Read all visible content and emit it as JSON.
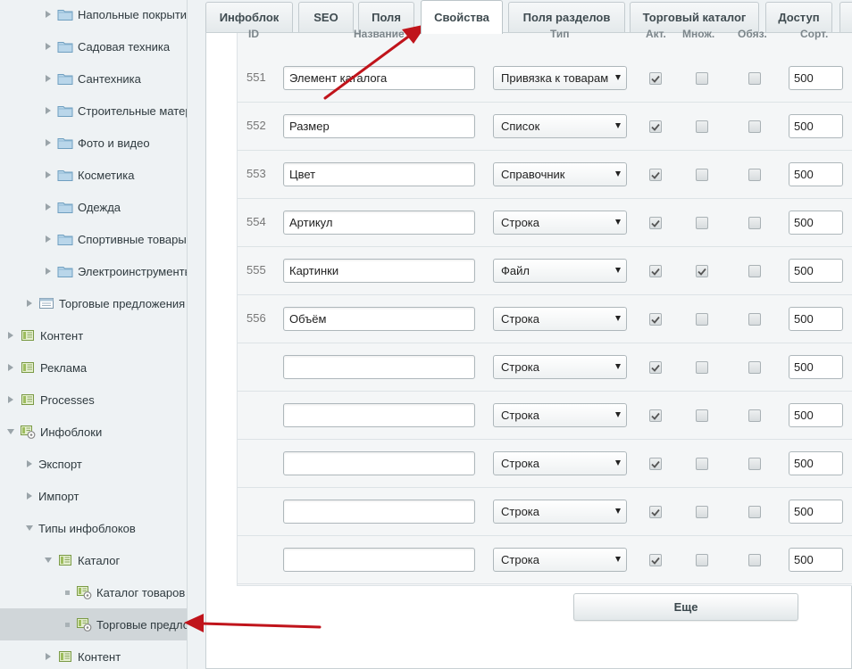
{
  "sidebar": {
    "items": [
      {
        "label": "Напольные покрытия",
        "level": 2,
        "expander": "collapsed",
        "icon": "folder-icon"
      },
      {
        "label": "Садовая техника",
        "level": 2,
        "expander": "collapsed",
        "icon": "folder-icon"
      },
      {
        "label": "Сантехника",
        "level": 2,
        "expander": "collapsed",
        "icon": "folder-icon"
      },
      {
        "label": "Строительные материалы",
        "level": 2,
        "expander": "collapsed",
        "icon": "folder-icon"
      },
      {
        "label": "Фото и видео",
        "level": 2,
        "expander": "collapsed",
        "icon": "folder-icon"
      },
      {
        "label": "Косметика",
        "level": 2,
        "expander": "collapsed",
        "icon": "folder-icon"
      },
      {
        "label": "Одежда",
        "level": 2,
        "expander": "collapsed",
        "icon": "folder-icon"
      },
      {
        "label": "Спортивные товары",
        "level": 2,
        "expander": "collapsed",
        "icon": "folder-icon"
      },
      {
        "label": "Электроинструменты",
        "level": 2,
        "expander": "collapsed",
        "icon": "folder-icon"
      },
      {
        "label": "Торговые предложения",
        "level": 1,
        "expander": "collapsed",
        "icon": "table-icon"
      },
      {
        "label": "Контент",
        "level": 0,
        "expander": "collapsed",
        "icon": "module-icon"
      },
      {
        "label": "Реклама",
        "level": 0,
        "expander": "collapsed",
        "icon": "module-icon"
      },
      {
        "label": "Processes",
        "level": 0,
        "expander": "collapsed",
        "icon": "module-icon"
      },
      {
        "label": "Инфоблоки",
        "level": 0,
        "expander": "expanded",
        "icon": "module-gear-icon"
      },
      {
        "label": "Экспорт",
        "level": 1,
        "expander": "collapsed",
        "icon": ""
      },
      {
        "label": "Импорт",
        "level": 1,
        "expander": "collapsed",
        "icon": ""
      },
      {
        "label": "Типы инфоблоков",
        "level": 1,
        "expander": "expanded",
        "icon": ""
      },
      {
        "label": "Каталог",
        "level": 2,
        "expander": "expanded",
        "icon": "module-icon"
      },
      {
        "label": "Каталог товаров",
        "level": 3,
        "expander": "bullet",
        "icon": "module-gear-icon"
      },
      {
        "label": "Торговые предложения",
        "level": 3,
        "expander": "bullet",
        "icon": "module-gear-icon",
        "selected": true
      },
      {
        "label": "Контент",
        "level": 2,
        "expander": "collapsed",
        "icon": "module-icon"
      }
    ]
  },
  "tabs": [
    {
      "label": "Инфоблок"
    },
    {
      "label": "SEO"
    },
    {
      "label": "Поля"
    },
    {
      "label": "Свойства",
      "active": true
    },
    {
      "label": "Поля разделов"
    },
    {
      "label": "Торговый каталог"
    },
    {
      "label": "Доступ"
    }
  ],
  "columns": [
    "ID",
    "Название",
    "Тип",
    "Акт.",
    "Множ.",
    "Обяз.",
    "Сорт."
  ],
  "rows": [
    {
      "id": "551",
      "name": "Элемент каталога",
      "type": "Привязка к товарам",
      "active": true,
      "multiple": false,
      "required": false,
      "sort": "500"
    },
    {
      "id": "552",
      "name": "Размер",
      "type": "Список",
      "active": true,
      "multiple": false,
      "required": false,
      "sort": "500"
    },
    {
      "id": "553",
      "name": "Цвет",
      "type": "Справочник",
      "active": true,
      "multiple": false,
      "required": false,
      "sort": "500"
    },
    {
      "id": "554",
      "name": "Артикул",
      "type": "Строка",
      "active": true,
      "multiple": false,
      "required": false,
      "sort": "500"
    },
    {
      "id": "555",
      "name": "Картинки",
      "type": "Файл",
      "active": true,
      "multiple": true,
      "required": false,
      "sort": "500"
    },
    {
      "id": "556",
      "name": "Объём",
      "type": "Строка",
      "active": true,
      "multiple": false,
      "required": false,
      "sort": "500"
    },
    {
      "id": "",
      "name": "",
      "type": "Строка",
      "active": true,
      "multiple": false,
      "required": false,
      "sort": "500"
    },
    {
      "id": "",
      "name": "",
      "type": "Строка",
      "active": true,
      "multiple": false,
      "required": false,
      "sort": "500"
    },
    {
      "id": "",
      "name": "",
      "type": "Строка",
      "active": true,
      "multiple": false,
      "required": false,
      "sort": "500"
    },
    {
      "id": "",
      "name": "",
      "type": "Строка",
      "active": true,
      "multiple": false,
      "required": false,
      "sort": "500"
    },
    {
      "id": "",
      "name": "",
      "type": "Строка",
      "active": true,
      "multiple": false,
      "required": false,
      "sort": "500"
    }
  ],
  "more_button": {
    "label": "Еще"
  },
  "colors": {
    "annotation_arrow": "#c0141b",
    "selected_row": "#d0d6d9",
    "checkmark": "#555555"
  }
}
